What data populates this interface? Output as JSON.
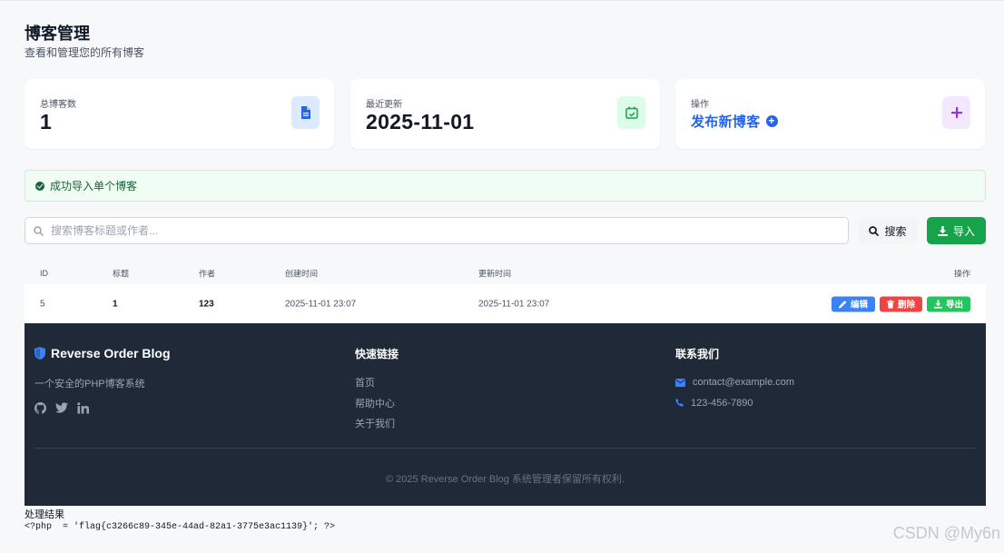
{
  "header": {
    "title": "博客管理",
    "subtitle": "查看和管理您的所有博客"
  },
  "stats": {
    "total": {
      "label": "总博客数",
      "value": "1",
      "icon": "document-icon",
      "color": "#2563eb",
      "bg": "#dbeafe"
    },
    "recent": {
      "label": "最近更新",
      "value": "2025-11-01",
      "icon": "calendar-check-icon",
      "color": "#16a34a",
      "bg": "#dcfce7"
    },
    "action": {
      "label": "操作",
      "value": "发布新博客",
      "icon": "plus-icon",
      "color": "#9333ea",
      "bg": "#f3e8ff"
    }
  },
  "alert": {
    "message": "成功导入单个博客"
  },
  "search": {
    "placeholder": "搜索博客标题或作者...",
    "value": "",
    "button_label": "搜索"
  },
  "import_button": {
    "label": "导入"
  },
  "table": {
    "columns": [
      "ID",
      "标题",
      "作者",
      "创建时间",
      "更新时间",
      "操作"
    ],
    "rows": [
      {
        "id": "5",
        "title": "1",
        "author": "123",
        "created": "2025-11-01 23:07",
        "updated": "2025-11-01 23:07"
      }
    ],
    "actions": {
      "edit": "编辑",
      "delete": "删除",
      "export": "导出"
    }
  },
  "footer": {
    "brand": "Reverse Order Blog",
    "description": "一个安全的PHP博客系统",
    "social": [
      "github-icon",
      "twitter-icon",
      "linkedin-icon"
    ],
    "links_heading": "快速链接",
    "links": [
      "首页",
      "帮助中心",
      "关于我们"
    ],
    "contact_heading": "联系我们",
    "email": "contact@example.com",
    "phone": "123-456-7890",
    "copyright": "© 2025 Reverse Order Blog 系统管理者保留所有权利."
  },
  "result": {
    "label": "处理结果",
    "code": "<?php  = 'flag{c3266c89-345e-44ad-82a1-3775e3ac1139}'; ?>"
  },
  "watermark": "CSDN @My6n"
}
